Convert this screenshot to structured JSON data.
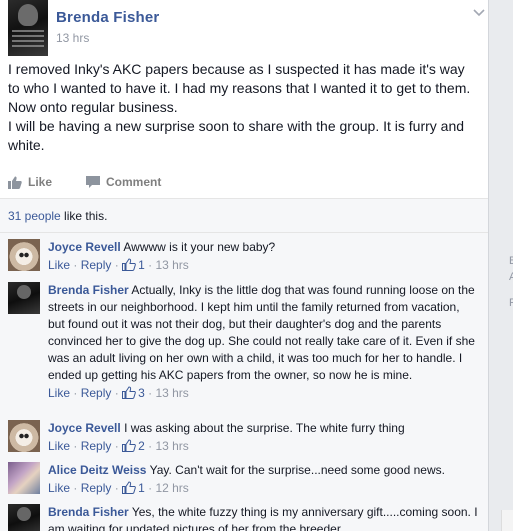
{
  "post": {
    "author": "Brenda Fisher",
    "time": "13 hrs",
    "paragraphs": [
      "I removed Inky's AKC papers because as I suspected it has made it's way to who I wanted to have it. I had my reasons that I wanted it to get to them. Now onto regular business.",
      "I will be having a new surprise soon to share with the group. It is furry and white."
    ],
    "actions": {
      "like": "Like",
      "comment": "Comment"
    },
    "likes": {
      "count_link": "31 people",
      "suffix": " like this."
    }
  },
  "comments": [
    {
      "name": "Joyce Revell",
      "text": "Awwww is it your new baby?",
      "like": "Like",
      "reply": "Reply",
      "likes": "1",
      "time": "13 hrs",
      "avatar": "dog-avatar"
    },
    {
      "name": "Brenda Fisher",
      "text": "Actually, Inky is the little dog that was found running loose on the streets in our neighborhood. I kept him until the family returned from vacation, but found out it was not their dog, but their daughter's dog and the parents convinced her to give the dog up. She could not really take care of it. Even if she was an adult living on her own with a child, it was too much for her to handle. I ended up getting his AKC papers from the owner, so now he is mine.",
      "like": "Like",
      "reply": "Reply",
      "likes": "3",
      "time": "13 hrs",
      "avatar": "profile-avatar"
    },
    {
      "name": "Joyce Revell",
      "text": "I was asking about the surprise. The white furry thing",
      "like": "Like",
      "reply": "Reply",
      "likes": "2",
      "time": "13 hrs",
      "avatar": "dog-avatar"
    },
    {
      "name": "Alice Deitz Weiss",
      "text": "Yay. Can't wait for the surprise...need some good news.",
      "like": "Like",
      "reply": "Reply",
      "likes": "1",
      "time": "12 hrs",
      "avatar": "family-avatar"
    },
    {
      "name": "Brenda Fisher",
      "text": "Yes, the white fuzzy thing is my anniversary gift.....coming soon. I am waiting for updated pictures of her from the breeder.",
      "avatar": "profile-avatar"
    }
  ],
  "sidebar": {
    "fragments": [
      "B",
      "A",
      "P"
    ]
  },
  "colors": {
    "link": "#3b5998",
    "meta": "#9197a3",
    "background": "#e9ebee"
  }
}
